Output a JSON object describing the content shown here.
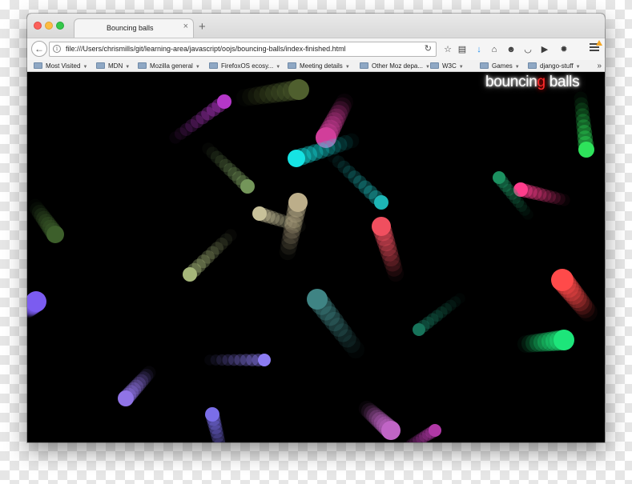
{
  "window": {
    "tab_title": "Bouncing balls",
    "tab_close_glyph": "×",
    "new_tab_glyph": "+"
  },
  "navbar": {
    "back_glyph": "←",
    "info_glyph": "i",
    "url": "file:///Users/chrismills/git/learning-area/javascript/oojs/bouncing-balls/index-finished.html",
    "reload_glyph": "↻",
    "toolbar_icons": [
      {
        "name": "bookmark-star-icon",
        "glyph": "☆"
      },
      {
        "name": "reading-list-icon",
        "glyph": "▤"
      },
      {
        "name": "download-icon",
        "glyph": "↓",
        "color": "#1a8cf0"
      },
      {
        "name": "home-icon",
        "glyph": "⌂"
      },
      {
        "name": "chat-icon",
        "glyph": "☻"
      },
      {
        "name": "pocket-icon",
        "glyph": "◡"
      },
      {
        "name": "youtube-icon",
        "glyph": "▶"
      },
      {
        "name": "firebug-icon",
        "glyph": "✹"
      }
    ],
    "menu_icon": "hamburger-menu-icon"
  },
  "bookmarks": [
    {
      "label": "Most Visited",
      "dropdown": true
    },
    {
      "label": "MDN",
      "dropdown": true
    },
    {
      "label": "Mozilla general",
      "dropdown": true
    },
    {
      "label": "FirefoxOS ecosy...",
      "dropdown": true
    },
    {
      "label": "Meeting details",
      "dropdown": true
    },
    {
      "label": "Other Moz depa...",
      "dropdown": true
    },
    {
      "label": "W3C",
      "dropdown": true
    },
    {
      "label": "Games",
      "dropdown": true
    },
    {
      "label": "django-stuff",
      "dropdown": true
    }
  ],
  "bookmarks_overflow": "»",
  "page": {
    "logo_left": "bouncin",
    "logo_dot": "g",
    "logo_right": " balls",
    "background_color": "#000000",
    "balls": [
      {
        "color": "#4f5f2e",
        "trail_color": "#4f5f2e"
      },
      {
        "color": "#b437c8",
        "trail_color": "#b437c8"
      },
      {
        "color": "#d13e9a",
        "trail_color": "#d13e9a"
      },
      {
        "color": "#16e3e3",
        "trail_color": "#16e3e3"
      },
      {
        "color": "#1db6b6",
        "trail_color": "#1db6b6"
      },
      {
        "color": "#74965a",
        "trail_color": "#74965a"
      },
      {
        "color": "#3d5f2b",
        "trail_color": "#3d5f2b"
      },
      {
        "color": "#c8c19a",
        "trail_color": "#c8c19a"
      },
      {
        "color": "#bcae8a",
        "trail_color": "#bcae8a"
      },
      {
        "color": "#a6b77a",
        "trail_color": "#a6b77a"
      },
      {
        "color": "#f04f5f",
        "trail_color": "#f04f5f"
      },
      {
        "color": "#17735a",
        "trail_color": "#17735a"
      },
      {
        "color": "#2ee35b",
        "trail_color": "#2ee35b"
      },
      {
        "color": "#ff3d8c",
        "trail_color": "#ff3d8c"
      },
      {
        "color": "#ff4a4a",
        "trail_color": "#ff4a4a"
      },
      {
        "color": "#7b5cf0",
        "trail_color": "#7b5cf0"
      },
      {
        "color": "#3f8484",
        "trail_color": "#3f8484"
      },
      {
        "color": "#1c9060",
        "trail_color": "#1c9060"
      },
      {
        "color": "#1de57a",
        "trail_color": "#1de57a"
      },
      {
        "color": "#8c7cf2",
        "trail_color": "#8c7cf2"
      },
      {
        "color": "#9074e6",
        "trail_color": "#9074e6"
      },
      {
        "color": "#7a6ee8",
        "trail_color": "#7a6ee8"
      },
      {
        "color": "#c065c6",
        "trail_color": "#c065c6"
      },
      {
        "color": "#b038a6",
        "trail_color": "#b038a6"
      }
    ]
  }
}
